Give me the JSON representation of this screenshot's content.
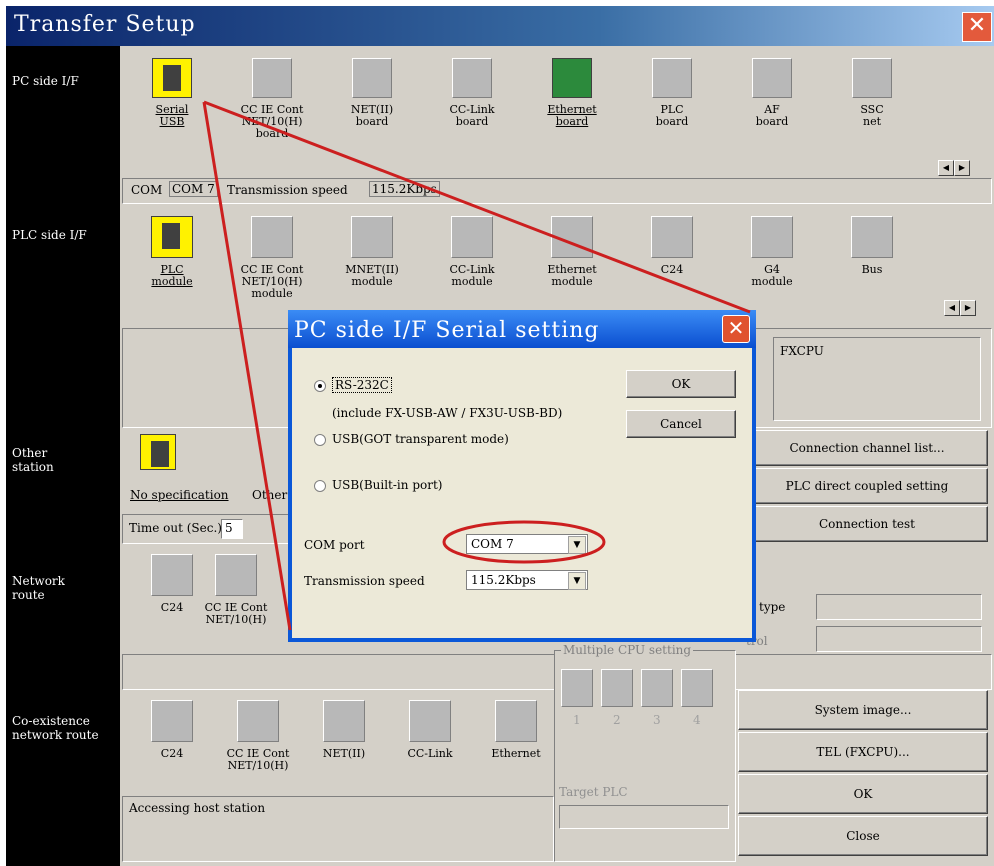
{
  "window": {
    "title": "Transfer Setup",
    "close_glyph": "✕"
  },
  "sections": {
    "pc_side": "PC side I/F",
    "plc_side": "PLC side I/F",
    "other_station": "Other\nstation",
    "network_route": "Network\nroute",
    "coexistence": "Co-existence\nnetwork route"
  },
  "pc_side_items": [
    {
      "label": "Serial\nUSB",
      "icon": "serial-usb-icon"
    },
    {
      "label": "CC IE Cont\nNET/10(H)\nboard",
      "icon": "board-icon"
    },
    {
      "label": "NET(II)\nboard",
      "icon": "board-icon"
    },
    {
      "label": "CC-Link\nboard",
      "icon": "board-icon"
    },
    {
      "label": "Ethernet\nboard",
      "icon": "ethernet-board-icon"
    },
    {
      "label": "PLC\nboard",
      "icon": "board-icon"
    },
    {
      "label": "AF\nboard",
      "icon": "board-icon"
    },
    {
      "label": "SSC\nnet",
      "icon": "board-icon"
    }
  ],
  "pc_status": {
    "com_label": "COM",
    "com_value": "COM 7",
    "speed_label": "Transmission speed",
    "speed_value": "115.2Kbps"
  },
  "plc_side_items": [
    {
      "label": "PLC\nmodule",
      "icon": "plc-module-icon"
    },
    {
      "label": "CC IE Cont\nNET/10(H)\nmodule",
      "icon": "module-icon"
    },
    {
      "label": "MNET(II)\nmodule",
      "icon": "module-icon"
    },
    {
      "label": "CC-Link\nmodule",
      "icon": "module-icon"
    },
    {
      "label": "Ethernet\nmodule",
      "icon": "module-icon"
    },
    {
      "label": "C24",
      "icon": "module-icon"
    },
    {
      "label": "G4\nmodule",
      "icon": "module-icon"
    },
    {
      "label": "Bus",
      "icon": "module-icon"
    }
  ],
  "plc_type": "FXCPU",
  "other_station": {
    "no_spec": "No specification",
    "other": "Other",
    "timeout_label": "Time out (Sec.)",
    "timeout_value": "5"
  },
  "network_items": [
    {
      "label": "C24"
    },
    {
      "label": "CC IE Cont\nNET/10(H)"
    }
  ],
  "network_side": {
    "type_label": "C type",
    "ctrl_label": "trol"
  },
  "multiple_cpu": {
    "title": "Multiple CPU setting",
    "numbers": [
      "1",
      "2",
      "3",
      "4"
    ],
    "target_label": "Target PLC"
  },
  "coexist_items": [
    {
      "label": "C24"
    },
    {
      "label": "CC IE Cont\nNET/10(H)"
    },
    {
      "label": "NET(II)"
    },
    {
      "label": "CC-Link"
    },
    {
      "label": "Ethernet"
    }
  ],
  "accessing": "Accessing host station",
  "right_buttons": [
    "Connection channel list...",
    "PLC direct coupled setting",
    "Connection test"
  ],
  "bottom_buttons": [
    "System image...",
    "TEL (FXCPU)...",
    "OK",
    "Close"
  ],
  "dialog": {
    "title": "PC side I/F  Serial setting",
    "options": [
      "RS-232C",
      "USB(GOT transparent mode)",
      "USB(Built-in port)"
    ],
    "rs232_note": "(include FX-USB-AW / FX3U-USB-BD)",
    "selected": 0,
    "ok": "OK",
    "cancel": "Cancel",
    "com_label": "COM port",
    "com_value": "COM 7",
    "speed_label": "Transmission speed",
    "speed_value": "115.2Kbps"
  },
  "colors": {
    "annotation": "#cc1f1f",
    "title_start": "#0a246a",
    "dialog_blue": "#0a57d8"
  }
}
